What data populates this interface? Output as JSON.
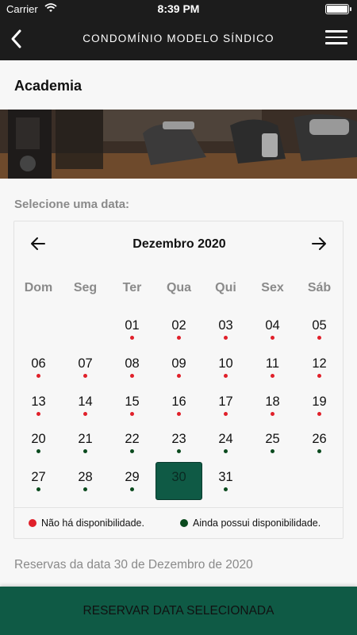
{
  "status": {
    "carrier": "Carrier",
    "time": "8:39 PM"
  },
  "navbar": {
    "title": "CONDOMÍNIO MODELO SÍNDICO"
  },
  "page": {
    "title": "Academia",
    "select_label": "Selecione uma data:"
  },
  "calendar": {
    "month": "Dezembro 2020",
    "weekdays": [
      "Dom",
      "Seg",
      "Ter",
      "Qua",
      "Qui",
      "Sex",
      "Sáb"
    ],
    "days": [
      {
        "label": "01",
        "status": "unavailable"
      },
      {
        "label": "02",
        "status": "unavailable"
      },
      {
        "label": "03",
        "status": "unavailable"
      },
      {
        "label": "04",
        "status": "unavailable"
      },
      {
        "label": "05",
        "status": "unavailable"
      },
      {
        "label": "06",
        "status": "unavailable"
      },
      {
        "label": "07",
        "status": "unavailable"
      },
      {
        "label": "08",
        "status": "unavailable"
      },
      {
        "label": "09",
        "status": "unavailable"
      },
      {
        "label": "10",
        "status": "unavailable"
      },
      {
        "label": "11",
        "status": "unavailable"
      },
      {
        "label": "12",
        "status": "unavailable"
      },
      {
        "label": "13",
        "status": "unavailable"
      },
      {
        "label": "14",
        "status": "unavailable"
      },
      {
        "label": "15",
        "status": "unavailable"
      },
      {
        "label": "16",
        "status": "unavailable"
      },
      {
        "label": "17",
        "status": "unavailable"
      },
      {
        "label": "18",
        "status": "unavailable"
      },
      {
        "label": "19",
        "status": "unavailable"
      },
      {
        "label": "20",
        "status": "available"
      },
      {
        "label": "21",
        "status": "available"
      },
      {
        "label": "22",
        "status": "available"
      },
      {
        "label": "23",
        "status": "available"
      },
      {
        "label": "24",
        "status": "available"
      },
      {
        "label": "25",
        "status": "available"
      },
      {
        "label": "26",
        "status": "available"
      },
      {
        "label": "27",
        "status": "available"
      },
      {
        "label": "28",
        "status": "available"
      },
      {
        "label": "29",
        "status": "available"
      },
      {
        "label": "30",
        "status": "available",
        "selected": true
      },
      {
        "label": "31",
        "status": "available"
      }
    ],
    "first_weekday_index": 2,
    "legend": {
      "unavailable": "Não há disponibilidade.",
      "available": "Ainda possui disponibilidade."
    }
  },
  "reservas_text": "Reservas da data 30 de Dezembro de 2020",
  "reserve_button": "RESERVAR DATA SELECIONADA",
  "colors": {
    "accent": "#0f5a45",
    "unavailable_dot": "#e0202a",
    "available_dot": "#0b4a1e",
    "navbar_bg": "#1c1c1c"
  },
  "icons": {
    "back": "chevron-left-icon",
    "menu": "hamburger-menu-icon",
    "prev": "arrow-left-icon",
    "next": "arrow-right-icon"
  }
}
